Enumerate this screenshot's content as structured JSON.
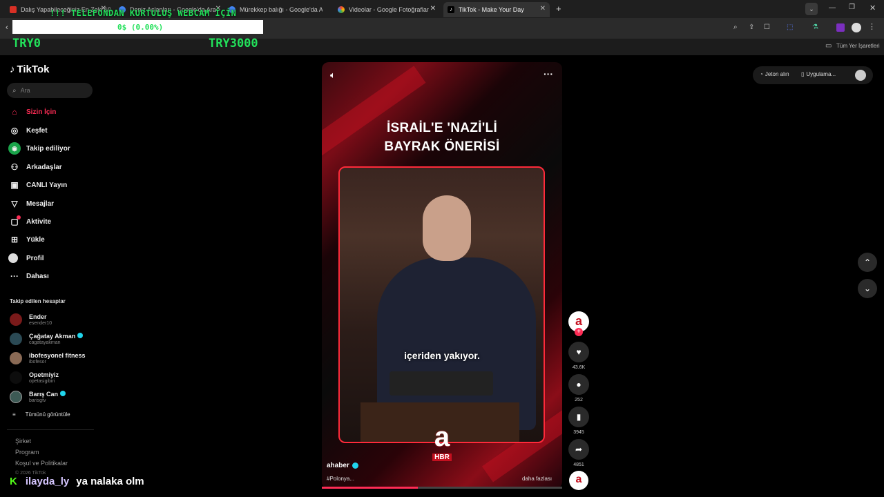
{
  "browser": {
    "tabs": [
      {
        "title": "Dalış Yapabileceğiniz En Zeki 10...",
        "color": "#d93025"
      },
      {
        "title": "Deniz Aslanları - Google'da Ara",
        "color": "#4285f4"
      },
      {
        "title": "Mürekkep balığı - Google'da Ar...",
        "color": "#4285f4"
      },
      {
        "title": "Videolar - Google Fotoğraflar",
        "color": "#fbbc04"
      },
      {
        "title": "TikTok - Make Your Day",
        "color": "#ffffff"
      }
    ],
    "new_tab": "+",
    "bookmarks_label": "Tüm Yer İşaretleri"
  },
  "stream_overlay": {
    "banner": "!!! TELEFONDAN KURTULUŞ WEBCAM İÇİN",
    "progress": "0$ (0.00%)",
    "left_amount": "TRY0",
    "right_amount": "TRY3000",
    "chat_user": "ilayda_ly",
    "chat_message": "ya nalaka olm",
    "chat_badge": "K"
  },
  "tiktok": {
    "logo": "TikTok",
    "search_placeholder": "Ara",
    "nav": [
      {
        "label": "Sizin İçin",
        "icon": "home-icon",
        "active": true
      },
      {
        "label": "Keşfet",
        "icon": "compass-icon"
      },
      {
        "label": "Takip ediliyor",
        "icon": "following-icon"
      },
      {
        "label": "Arkadaşlar",
        "icon": "friends-icon"
      },
      {
        "label": "CANLI Yayın",
        "icon": "live-icon"
      },
      {
        "label": "Mesajlar",
        "icon": "messages-icon"
      },
      {
        "label": "Aktivite",
        "icon": "activity-icon"
      },
      {
        "label": "Yükle",
        "icon": "upload-icon"
      },
      {
        "label": "Profil",
        "icon": "profile-icon"
      },
      {
        "label": "Dahası",
        "icon": "more-icon"
      }
    ],
    "following_title": "Takip edilen hesaplar",
    "following": [
      {
        "name": "Ender",
        "handle": "esender10",
        "verified": false
      },
      {
        "name": "Çağatay Akman",
        "handle": "cagatayakman",
        "verified": true
      },
      {
        "name": "ibofesyonel fitness",
        "handle": "ibofesor",
        "verified": false
      },
      {
        "name": "Opetmiyiz",
        "handle": "opetasigibiri",
        "verified": false
      },
      {
        "name": "Barış Can",
        "handle": "barisgtv",
        "verified": true
      }
    ],
    "see_all": "Tümünü görüntüle",
    "footer": [
      "Şirket",
      "Program",
      "Koşul ve Politikalar"
    ],
    "copyright": "© 2026 TikTok",
    "top_right": {
      "coins": "Jeton alın",
      "app": "Uygulama..."
    },
    "video": {
      "headline_line1": "İSRAİL'E 'NAZİ'Lİ",
      "headline_line2": "BAYRAK ÖNERİSİ",
      "subtitle": "içeriden yakıyor.",
      "author": "ahaber",
      "hashtag": "#Polonya...",
      "more": "daha fazlası",
      "channel_logo": "a",
      "channel_sub": "HBR"
    },
    "actions": {
      "likes": "43.6K",
      "comments": "252",
      "saves": "3945",
      "shares": "4851"
    }
  }
}
